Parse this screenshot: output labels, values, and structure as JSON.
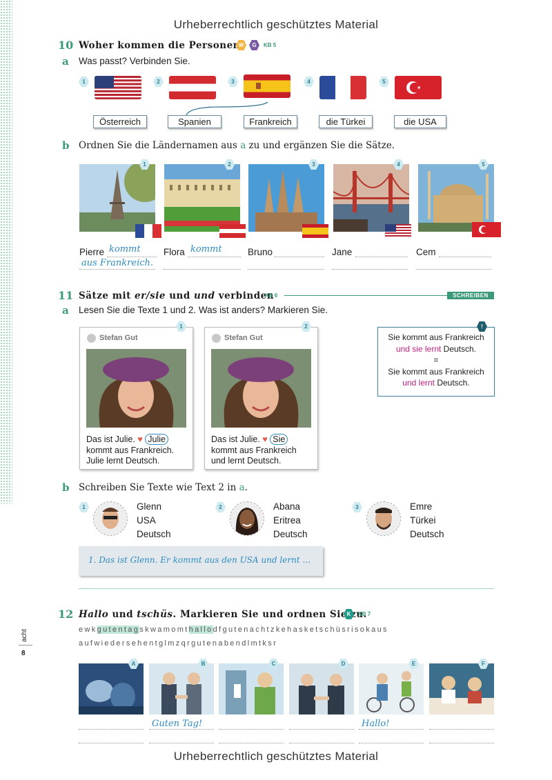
{
  "watermark_top": "Urheberrechtlich geschütztes Material",
  "watermark_bottom": "Urheberrechtlich geschütztes Material",
  "ex10": {
    "num": "10",
    "title": "Woher kommen die Personen?",
    "badges": [
      "W",
      "G"
    ],
    "kb": "KB 5",
    "a": {
      "letter": "a",
      "instr": "Was passt? Verbinden Sie.",
      "flags": [
        {
          "n": "1",
          "icon": "usa-flag-icon"
        },
        {
          "n": "2",
          "icon": "austria-flag-icon"
        },
        {
          "n": "3",
          "icon": "spain-flag-icon"
        },
        {
          "n": "4",
          "icon": "france-flag-icon"
        },
        {
          "n": "5",
          "icon": "turkey-flag-icon"
        }
      ],
      "countries": [
        "Österreich",
        "Spanien",
        "Frankreich",
        "die Türkei",
        "die USA"
      ]
    },
    "b": {
      "letter": "b",
      "instr_pre": "Ordnen Sie die Ländernamen aus ",
      "instr_a": "a",
      "instr_post": " zu und ergänzen Sie die Sätze.",
      "photos": [
        {
          "n": "1",
          "name": "Pierre",
          "hand1": "kommt",
          "hand2": "aus Frankreich."
        },
        {
          "n": "2",
          "name": "Flora",
          "hand1": "kommt",
          "hand2": ""
        },
        {
          "n": "3",
          "name": "Bruno",
          "hand1": "",
          "hand2": ""
        },
        {
          "n": "4",
          "name": "Jane",
          "hand1": "",
          "hand2": ""
        },
        {
          "n": "5",
          "name": "Cem",
          "hand1": "",
          "hand2": ""
        }
      ]
    }
  },
  "ex11": {
    "num": "11",
    "title_parts": [
      "Sätze mit ",
      "er/sie",
      " und ",
      "und",
      " verbinden"
    ],
    "kb": "KB 6",
    "tag": "SCHREIBEN",
    "a": {
      "letter": "a",
      "instr": "Lesen Sie die Texte 1 und 2. Was ist anders? Markieren Sie.",
      "posts": [
        {
          "n": "1",
          "author": "Stefan Gut",
          "l1": "Das ist Julie.",
          "circled": "Julie",
          "l2": "kommt aus Frankreich.",
          "l3": "Julie lernt Deutsch."
        },
        {
          "n": "2",
          "author": "Stefan Gut",
          "l1": "Das ist Julie.",
          "circled": "Sie",
          "l2": "kommt aus Frankreich",
          "l3": "und lernt Deutsch."
        }
      ],
      "info": {
        "badge": "!",
        "l1": "Sie kommt aus Frankreich",
        "l2a": "und sie lernt",
        "l2b": " Deutsch.",
        "eq": "=",
        "l3": "Sie kommt aus Frankreich",
        "l4a": "und lernt",
        "l4b": " Deutsch."
      }
    },
    "b": {
      "letter": "b",
      "instr_pre": "Schreiben Sie Texte wie Text 2 in ",
      "instr_a": "a",
      "instr_post": ".",
      "people": [
        {
          "n": "1",
          "name": "Glenn",
          "country": "USA",
          "lang": "Deutsch"
        },
        {
          "n": "2",
          "name": "Abana",
          "country": "Eritrea",
          "lang": "Deutsch"
        },
        {
          "n": "3",
          "name": "Emre",
          "country": "Türkei",
          "lang": "Deutsch"
        }
      ],
      "answer": "1.  Das ist Glenn. Er kommt  aus den USA und lernt ..."
    }
  },
  "ex12": {
    "num": "12",
    "title_parts": [
      "Hallo",
      " und ",
      "tschüs",
      ". Markieren Sie und ordnen Sie zu."
    ],
    "badge": "K",
    "kb": "KB 7",
    "line1": [
      "ewk",
      "gutentag",
      "skwamomt",
      "hallo",
      "dfgutenachtzkehasketschüsrisokaus"
    ],
    "line2": "aufwiedersehentglmzqrgutenabendlmtksr",
    "scenes": [
      {
        "letter": "A",
        "answer": ""
      },
      {
        "letter": "B",
        "answer": "Guten Tag!"
      },
      {
        "letter": "C",
        "answer": ""
      },
      {
        "letter": "D",
        "answer": ""
      },
      {
        "letter": "E",
        "answer": "Hallo!"
      },
      {
        "letter": "F",
        "answer": ""
      }
    ]
  },
  "page": {
    "word": "acht",
    "number": "8"
  }
}
